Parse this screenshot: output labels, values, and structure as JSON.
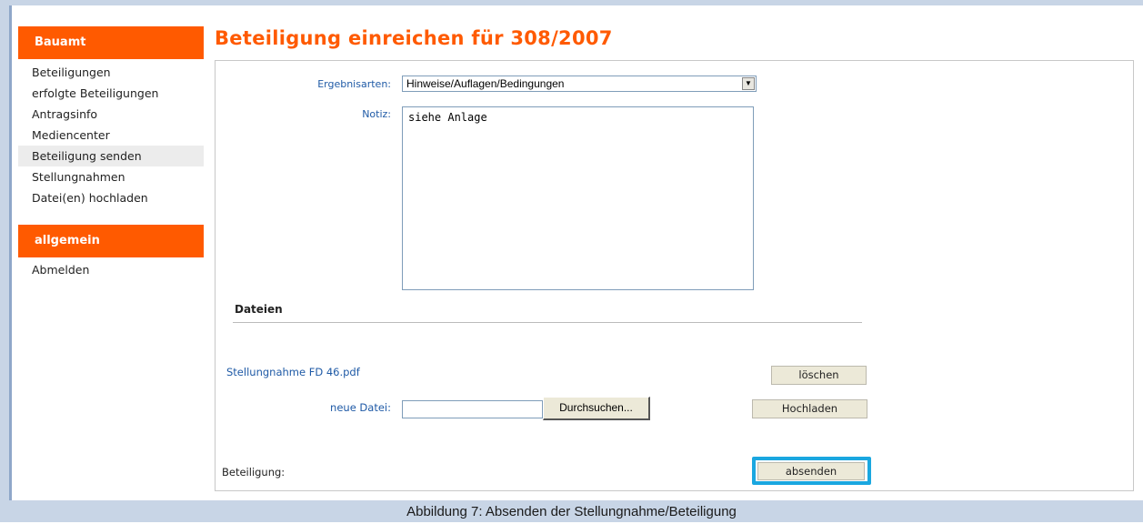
{
  "sidebar": {
    "section1_header": "Bauamt",
    "section1_items": [
      {
        "label": "Beteiligungen"
      },
      {
        "label": "erfolgte Beteiligungen"
      },
      {
        "label": "Antragsinfo"
      },
      {
        "label": "Mediencenter"
      },
      {
        "label": "Beteiligung senden"
      },
      {
        "label": "Stellungnahmen"
      },
      {
        "label": "Datei(en) hochladen"
      }
    ],
    "section2_header": "allgemein",
    "section2_items": [
      {
        "label": "Abmelden"
      }
    ]
  },
  "page": {
    "title": "Beteiligung einreichen für 308/2007"
  },
  "form": {
    "ergebnisarten_label": "Ergebnisarten:",
    "ergebnisarten_value": "Hinweise/Auflagen/Bedingungen",
    "notiz_label": "Notiz:",
    "notiz_value": "siehe Anlage",
    "dateien_heading": "Dateien",
    "existing_file_name": "Stellungnahme FD 46.pdf",
    "delete_button": "löschen",
    "new_file_label": "neue Datei:",
    "new_file_value": "",
    "browse_button": "Durchsuchen...",
    "upload_button": "Hochladen",
    "beteiligung_label": "Beteiligung:",
    "submit_button": "absenden"
  },
  "caption": "Abbildung 7: Absenden der Stellungnahme/Beteiligung",
  "colors": {
    "accent": "#ff5a00",
    "link": "#1f5aa6",
    "highlight": "#1aa7e0",
    "frame": "#c8d5e6"
  }
}
